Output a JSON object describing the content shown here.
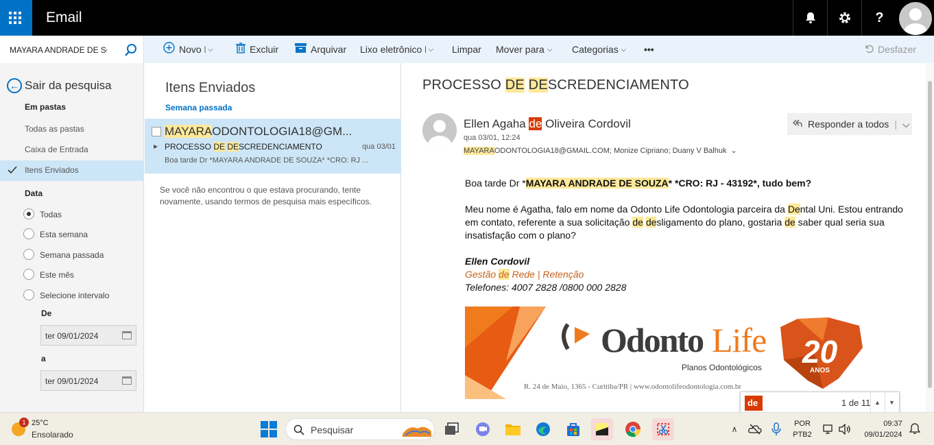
{
  "app": {
    "title": "Email"
  },
  "search": {
    "value": "MAYARA ANDRADE DE SOUZA"
  },
  "toolbar": {
    "new_label": "Novo",
    "delete_label": "Excluir",
    "archive_label": "Arquivar",
    "junk_label": "Lixo eletrônico",
    "sweep_label": "Limpar",
    "move_label": "Mover para",
    "categories_label": "Categorias",
    "more_label": "•••",
    "undo_label": "Desfazer"
  },
  "nav": {
    "exit_search": "Sair da pesquisa",
    "in_folders": "Em pastas",
    "folders": [
      "Todas as pastas",
      "Caixa de Entrada",
      "Itens Enviados"
    ],
    "date_heading": "Data",
    "date_options": [
      "Todas",
      "Esta semana",
      "Semana passada",
      "Este mês",
      "Selecione intervalo"
    ],
    "from_label": "De",
    "from_value": "ter 09/01/2024",
    "to_label": "a",
    "to_value": "ter 09/01/2024"
  },
  "list": {
    "folder_title": "Itens Enviados",
    "group_label": "Semana passada",
    "item": {
      "from_hl": "MAYARA",
      "from_rest": "ODONTOLOGIA18@GM...",
      "subject_a": "PROCESSO ",
      "subject_hl1": "DE",
      "subject_b": " ",
      "subject_hl2": "DE",
      "subject_c": "SCREDENCIAMENTO",
      "date": "qua 03/01",
      "preview": "Boa tarde Dr *MAYARA ANDRADE DE SOUZA* *CRO: RJ ..."
    },
    "not_found": "Se você não encontrou o que estava procurando, tente novamente, usando termos de pesquisa mais específicos."
  },
  "message": {
    "subject_a": "PROCESSO ",
    "subject_hl1": "DE",
    "subject_b": " ",
    "subject_hl2": "DE",
    "subject_c": "SCREDENCIAMENTO",
    "from_a": "Ellen Agaha ",
    "from_hl": "de",
    "from_b": " Oliveira Cordovil",
    "date": "qua 03/01, 12:24",
    "to_hl": "MAYARA",
    "to_rest": "ODONTOLOGIA18@GMAIL.COM; Monize Cipriano; Duany V Balhuk",
    "reply_all": "Responder a todos",
    "greeting_a": "Boa tarde Dr *",
    "greeting_hl": "MAYARA ANDRADE DE SOUZA",
    "greeting_b": "* *CRO:  RJ - 43192*, tudo bem?",
    "p1_a": "Meu nome é Agatha, falo em nome da Odonto Life Odontologia parceira da ",
    "p1_hl1": "De",
    "p1_b": "ntal Uni. Estou entrando em contato, referente a sua solicitação ",
    "p1_hl2": "de",
    "p1_c": " ",
    "p1_hl3": "de",
    "p1_d": "sligamento do plano, gostaria ",
    "p1_hl4": "de",
    "p1_e": " saber qual seria sua insatisfação com o plano?",
    "sig_name": "Ellen Cordovil",
    "sig_role_a": "Gestão ",
    "sig_role_hl": "de",
    "sig_role_b": " Rede | Retenção",
    "sig_tel": "Telefones: 4007 2828 /0800 000 2828"
  },
  "banner": {
    "brand_a": "Odonto",
    "brand_b": "Life",
    "tagline": "Planos Odontológicos",
    "address": "R. 24 de Maio, 1365 - Curitiba/PR  |  www.odontolifeodontologia.com.br",
    "anniv": "20",
    "anniv_sub": "ANOS",
    "colors": {
      "orange": "#f07b1d",
      "gray": "#3c3c3c"
    }
  },
  "find": {
    "query": "de",
    "count": "1 de 11"
  },
  "taskbar": {
    "weather_badge": "1",
    "temp": "25°C",
    "condition": "Ensolarado",
    "search_placeholder": "Pesquisar",
    "lang_a": "POR",
    "lang_b": "PTB2",
    "time": "09:37",
    "date": "09/01/2024"
  }
}
